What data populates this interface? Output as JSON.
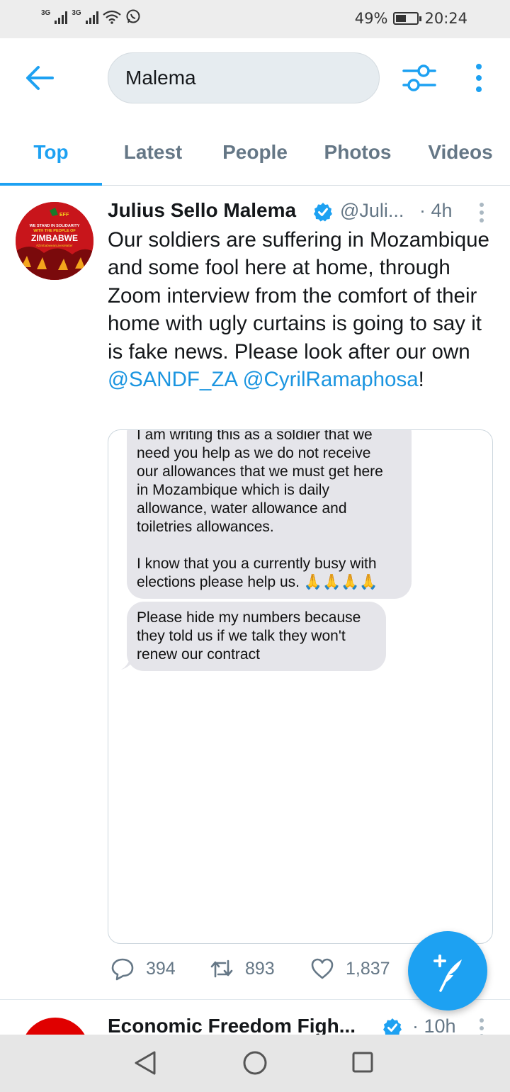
{
  "status_bar": {
    "network_1": "3G",
    "network_2": "3G",
    "battery_percent": "49%",
    "battery_level": 0.49,
    "time": "20:24",
    "icons": [
      "signal-icon",
      "signal-icon",
      "wifi-icon",
      "whatsapp-icon",
      "battery-icon"
    ]
  },
  "header": {
    "search_value": "Malema",
    "icons": [
      "back-arrow-icon",
      "filter-icon",
      "more-vertical-icon"
    ]
  },
  "tabs": [
    {
      "label": "Top",
      "active": true
    },
    {
      "label": "Latest",
      "active": false
    },
    {
      "label": "People",
      "active": false
    },
    {
      "label": "Photos",
      "active": false
    },
    {
      "label": "Videos",
      "active": false
    }
  ],
  "tweet": {
    "author_name": "Julius Sello Malema",
    "handle": "@Juli...",
    "time": "· 4h",
    "verified": true,
    "avatar_text": {
      "line1": "WE STAND IN SOLIDARITY",
      "line2": "WITH THE PEOPLE OF",
      "line3": "ZIMBABWE",
      "line4": "#ZimbabweanLivesMatter",
      "logo": "EFF"
    },
    "text_part1": "Our soldiers are suffering in Mozambique and some fool here at home, through Zoom interview from the comfort of their home with ugly curtains is going to say it is fake news. Please look after our own ",
    "mention_1": "@SANDF_ZA",
    "mention_2": "@CyrilRamaphosa",
    "text_end": "!",
    "image": {
      "bubble_1_lines": [
        "I am writing this as a soldier that we",
        "need you help as we do not receive",
        "our allowances that we must get here",
        "in Mozambique which is daily",
        "allowance, water allowance and",
        "toiletries allowances.",
        "",
        "I know that you a currently busy with",
        "elections please help us. 🙏🙏🙏🙏"
      ],
      "bubble_2_lines": [
        "Please hide my numbers because",
        "they told us if we talk they won't",
        "renew our contract"
      ]
    },
    "actions": {
      "replies": "394",
      "retweets": "893",
      "likes": "1,837"
    }
  },
  "tweet_2": {
    "author_name": "Economic Freedom Figh...",
    "time": "· 10h",
    "verified": true
  },
  "fab": {
    "icon": "compose-tweet-icon"
  },
  "nav_bar": {
    "icons": [
      "nav-back-icon",
      "nav-home-icon",
      "nav-recents-icon"
    ]
  },
  "colors": {
    "accent": "#1da1f2",
    "link": "#1b95e0",
    "secondary_text": "#657786",
    "bubble": "#e5e5ea"
  }
}
